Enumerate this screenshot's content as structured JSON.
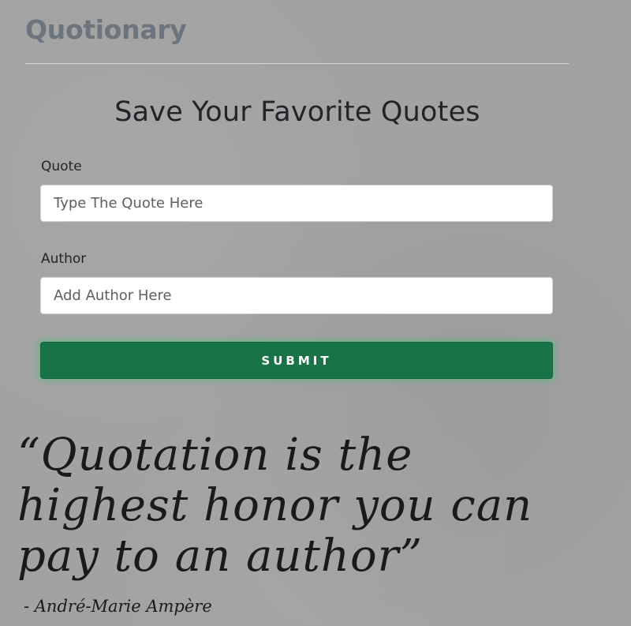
{
  "header": {
    "brand": "Quotionary"
  },
  "form": {
    "title": "Save Your Favorite Quotes",
    "quote_label": "Quote",
    "quote_placeholder": "Type The Quote Here",
    "author_label": "Author",
    "author_placeholder": "Add Author Here",
    "submit_label": "SUBMIT"
  },
  "featured_quote": {
    "text": "“Quotation is the highest honor you can pay to an author”",
    "attribution": "- André-Marie Ampère"
  },
  "colors": {
    "background": "#a2a2a2",
    "brand_text": "#6c757d",
    "submit_button": "#187347",
    "submit_glow": "#28c86e"
  }
}
